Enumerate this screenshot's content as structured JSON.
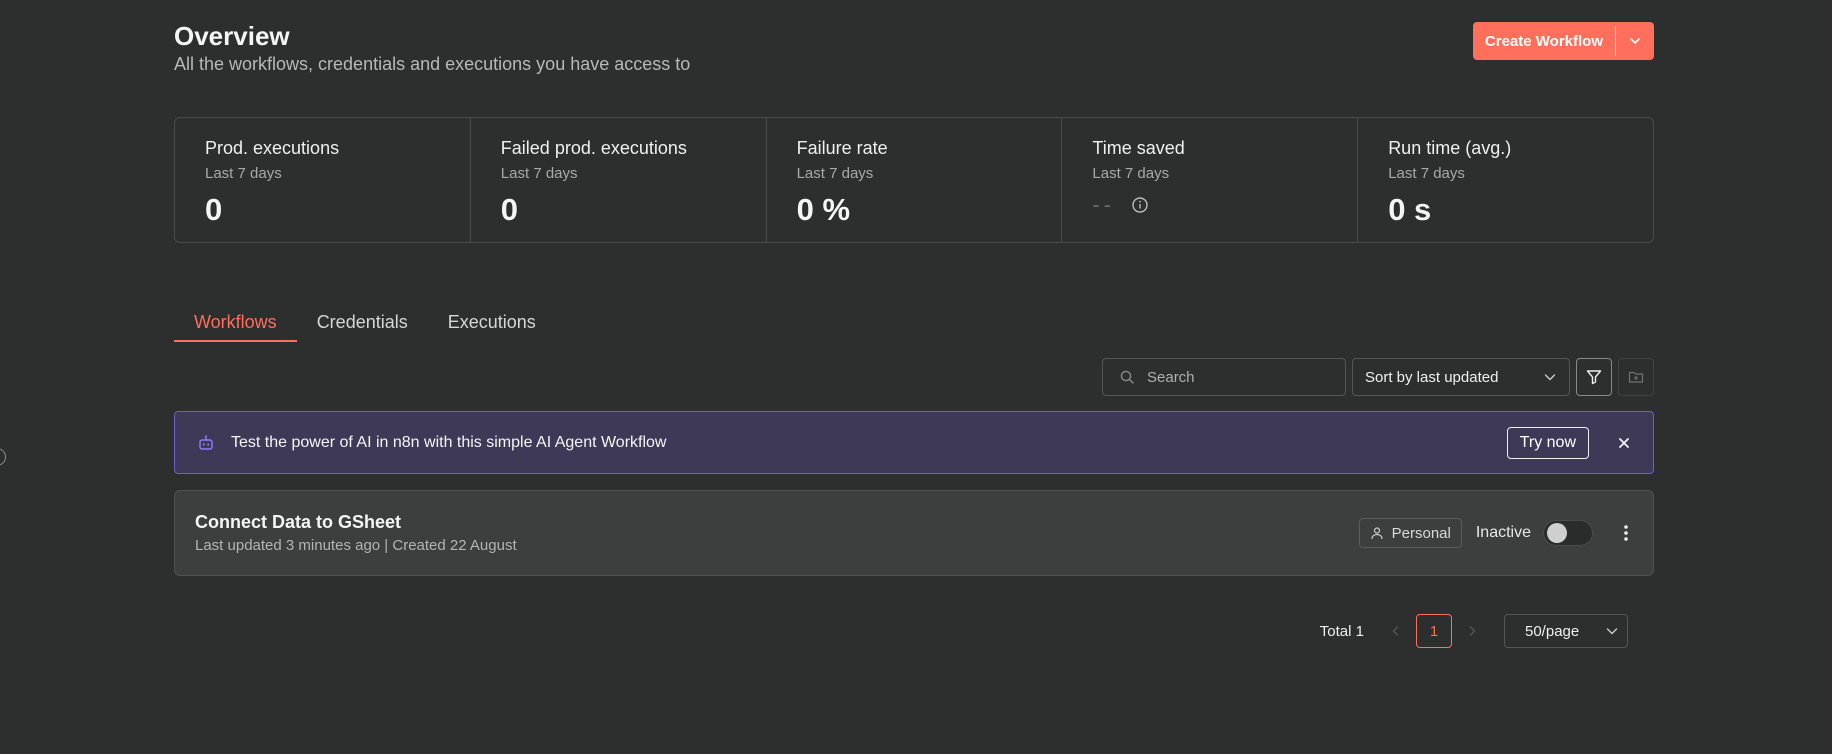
{
  "header": {
    "title": "Overview",
    "subtitle": "All the workflows, credentials and executions you have access to",
    "create_label": "Create Workflow"
  },
  "stats": [
    {
      "label": "Prod. executions",
      "period": "Last 7 days",
      "value": "0"
    },
    {
      "label": "Failed prod. executions",
      "period": "Last 7 days",
      "value": "0"
    },
    {
      "label": "Failure rate",
      "period": "Last 7 days",
      "value": "0 %"
    },
    {
      "label": "Time saved",
      "period": "Last 7 days",
      "value": "--"
    },
    {
      "label": "Run time (avg.)",
      "period": "Last 7 days",
      "value": "0 s"
    }
  ],
  "tabs": [
    {
      "label": "Workflows",
      "active": true
    },
    {
      "label": "Credentials",
      "active": false
    },
    {
      "label": "Executions",
      "active": false
    }
  ],
  "toolbar": {
    "search_placeholder": "Search",
    "sort_value": "Sort by last updated"
  },
  "banner": {
    "text": "Test the power of AI in n8n with this simple AI Agent Workflow",
    "action_label": "Try now"
  },
  "workflow": {
    "name": "Connect Data to GSheet",
    "meta": "Last updated 3 minutes ago | Created 22 August",
    "owner": "Personal",
    "status": "Inactive",
    "active": false
  },
  "pagination": {
    "total": "Total 1",
    "current_page": "1",
    "page_size": "50/page"
  },
  "colors": {
    "accent": "#ff6f5c",
    "banner_bg": "#3f3958",
    "banner_border": "#6a5fd0",
    "background": "#2d2e2e"
  }
}
